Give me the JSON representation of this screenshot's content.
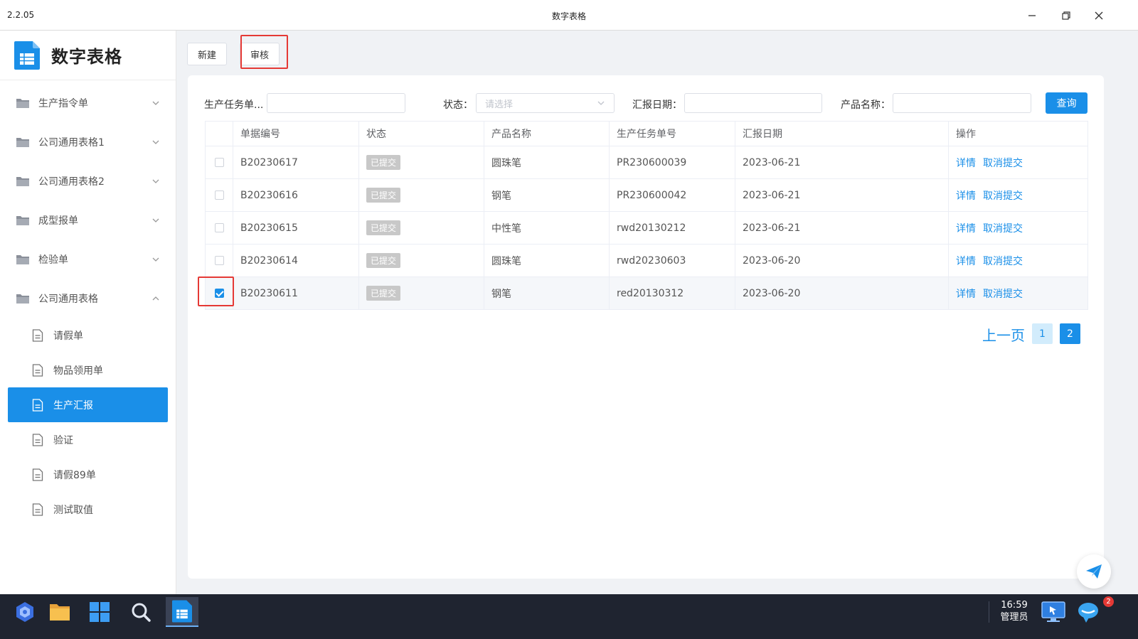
{
  "window": {
    "version": "2.2.05",
    "title": "数字表格"
  },
  "sidebar": {
    "brand": "数字表格",
    "groups": [
      {
        "label": "生产指令单",
        "expanded": false
      },
      {
        "label": "公司通用表格1",
        "expanded": false
      },
      {
        "label": "公司通用表格2",
        "expanded": false
      },
      {
        "label": "成型报单",
        "expanded": false
      },
      {
        "label": "检验单",
        "expanded": false
      },
      {
        "label": "公司通用表格",
        "expanded": true
      }
    ],
    "sub_items": [
      {
        "label": "请假单",
        "active": false
      },
      {
        "label": "物品领用单",
        "active": false
      },
      {
        "label": "生产汇报",
        "active": true
      },
      {
        "label": "验证",
        "active": false
      },
      {
        "label": "请假89单",
        "active": false
      },
      {
        "label": "测试取值",
        "active": false
      }
    ]
  },
  "toolbar": {
    "new_label": "新建",
    "review_label": "审核"
  },
  "filters": {
    "task_no_label": "生产任务单...",
    "task_no_value": "",
    "status_label": "状态：",
    "status_placeholder": "请选择",
    "date_label": "汇报日期：",
    "date_value": "",
    "product_label": "产品名称：",
    "product_value": "",
    "query_label": "查询"
  },
  "table": {
    "headers": [
      "单据编号",
      "状态",
      "产品名称",
      "生产任务单号",
      "汇报日期",
      "操作"
    ],
    "rows": [
      {
        "checked": false,
        "no": "B20230617",
        "status": "已提交",
        "product": "圆珠笔",
        "task": "PR230600039",
        "date": "2023-06-21",
        "act_detail": "详情",
        "act_cancel": "取消提交"
      },
      {
        "checked": false,
        "no": "B20230616",
        "status": "已提交",
        "product": "钢笔",
        "task": "PR230600042",
        "date": "2023-06-21",
        "act_detail": "详情",
        "act_cancel": "取消提交"
      },
      {
        "checked": false,
        "no": "B20230615",
        "status": "已提交",
        "product": "中性笔",
        "task": "rwd20130212",
        "date": "2023-06-21",
        "act_detail": "详情",
        "act_cancel": "取消提交"
      },
      {
        "checked": false,
        "no": "B20230614",
        "status": "已提交",
        "product": "圆珠笔",
        "task": "rwd20230603",
        "date": "2023-06-20",
        "act_detail": "详情",
        "act_cancel": "取消提交"
      },
      {
        "checked": true,
        "no": "B20230611",
        "status": "已提交",
        "product": "钢笔",
        "task": "red20130312",
        "date": "2023-06-20",
        "act_detail": "详情",
        "act_cancel": "取消提交"
      }
    ]
  },
  "pagination": {
    "prev_label": "上一页",
    "pages": [
      "1",
      "2"
    ],
    "current": "2"
  },
  "taskbar": {
    "time": "16:59",
    "user": "管理员",
    "notification_count": "2"
  },
  "colors": {
    "accent": "#1a8fe8",
    "highlight": "#e53935",
    "taskbar": "#1f2430"
  }
}
